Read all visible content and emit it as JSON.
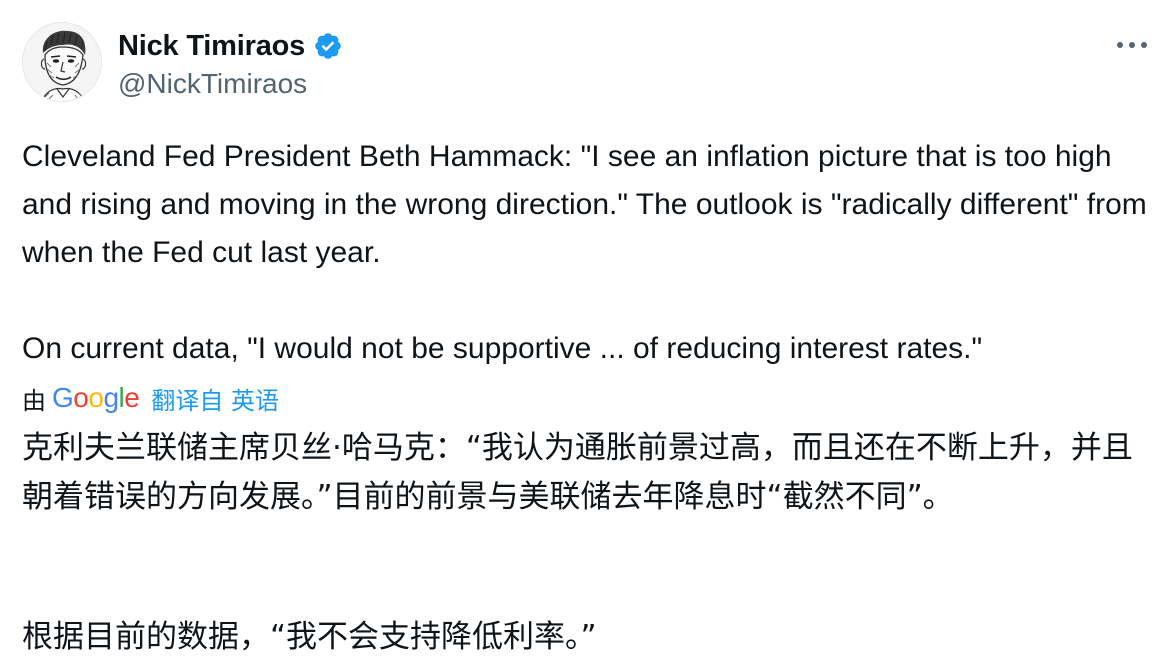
{
  "author": {
    "display_name": "Nick Timiraos",
    "handle": "@NickTimiraos",
    "verified": true,
    "avatar_icon": "sketch-portrait-avatar",
    "verified_color": "#1d9bf0"
  },
  "tweet": {
    "paragraphs": [
      "Cleveland Fed President Beth Hammack: \"I see an inflation picture that is too high and rising and moving in the wrong direction.\" The outlook is \"radically different\" from when the Fed cut last year.",
      "On current data, \"I would not be supportive ... of reducing interest rates.\""
    ]
  },
  "translation": {
    "prefix": "由",
    "provider": "Google",
    "link_label": "翻译自 英语",
    "link_color": "#1d9bf0",
    "paragraphs": [
      "克利夫兰联储主席贝丝·哈马克：“我认为通胀前景过高，而且还在不断上升，并且朝着错误的方向发展。”目前的前景与美联储去年降息时“截然不同”。",
      "根据目前的数据，“我不会支持降低利率。”"
    ]
  },
  "menu": {
    "more_icon": "more-horizontal-icon"
  }
}
